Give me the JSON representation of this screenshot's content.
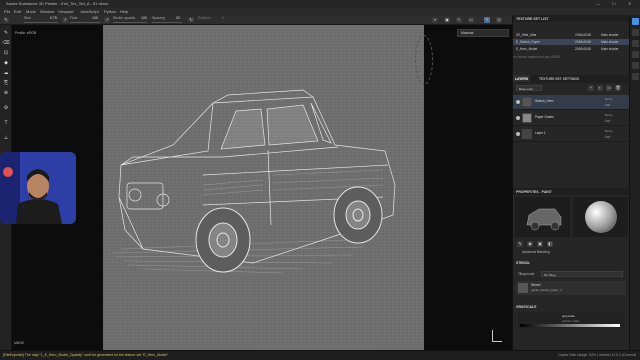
{
  "window": {
    "title": "Adobe Substance 3D Painter - Emi_Tex_Set_A - 01 demo",
    "controls": [
      "—",
      "☐",
      "✕"
    ]
  },
  "menu": [
    "File",
    "Edit",
    "Mode",
    "Window",
    "Viewport",
    "JavaScript",
    "Python",
    "Help"
  ],
  "toolbar": {
    "size_label": "Size",
    "size_value": "0.75",
    "flow_label": "Flow",
    "flow_value": "100",
    "stroke_opacity_label": "Stroke opacity",
    "stroke_opacity_value": "100",
    "spacing_label": "Spacing",
    "spacing_value": "20",
    "rotation_label": "Rotation",
    "rotation_value": "0"
  },
  "viewport": {
    "profile_label": "Profile: sRGB",
    "mode": "Material",
    "mask_label": "MASK"
  },
  "texture_set_list": {
    "title": "TEXTURE SET LIST",
    "rows": [
      {
        "name": "SE_Wall_Altar",
        "res": "2048x2048",
        "shader": "Main shader"
      },
      {
        "name": "E_Sketch_Paper",
        "res": "2048x2048",
        "shader": "Main shader"
      },
      {
        "name": "E_Hero_Model",
        "res": "2048x2048",
        "shader": "Main shader"
      }
    ],
    "note": "no texture material on geo #2048"
  },
  "layers": {
    "tabs": [
      "LAYERS",
      "TEXTURE SET SETTINGS"
    ],
    "channel": "Base color",
    "items": [
      {
        "name": "Sketch_Hero",
        "blend": "Norm",
        "opacity": "100"
      },
      {
        "name": "Paper Grains",
        "blend": "Norm",
        "opacity": "100"
      },
      {
        "name": "Layer 1",
        "blend": "Norm",
        "opacity": "100"
      }
    ]
  },
  "properties": {
    "title": "PROPERTIES - PAINT",
    "advanced_blending": "Advanced Blending",
    "stencil_label": "STENCIL",
    "tiling_mode_label": "Tiling mode",
    "tiling_mode_value": "No Tiling",
    "stencil_name": "Stencil",
    "stencil_file": "rgb32_sketch_paper_4",
    "grayscale_label": "GRAYSCALE",
    "grayscale_value": "grayscale",
    "uniform_color": "uniform color"
  },
  "status": {
    "message": "[FileExporter] The map \"1_E_Hero_Model_Opacity\" can't be generated for the texture set \"E_Hero_Model\"",
    "right": "Cache Disk Usage: 92% | Version 11.0.2 (Current)"
  },
  "colors": {
    "accent": "#4a90e2",
    "paper": "#6e6e6e",
    "webcam_bg": "#2d3ea6",
    "status_warning": "#e0c060"
  }
}
